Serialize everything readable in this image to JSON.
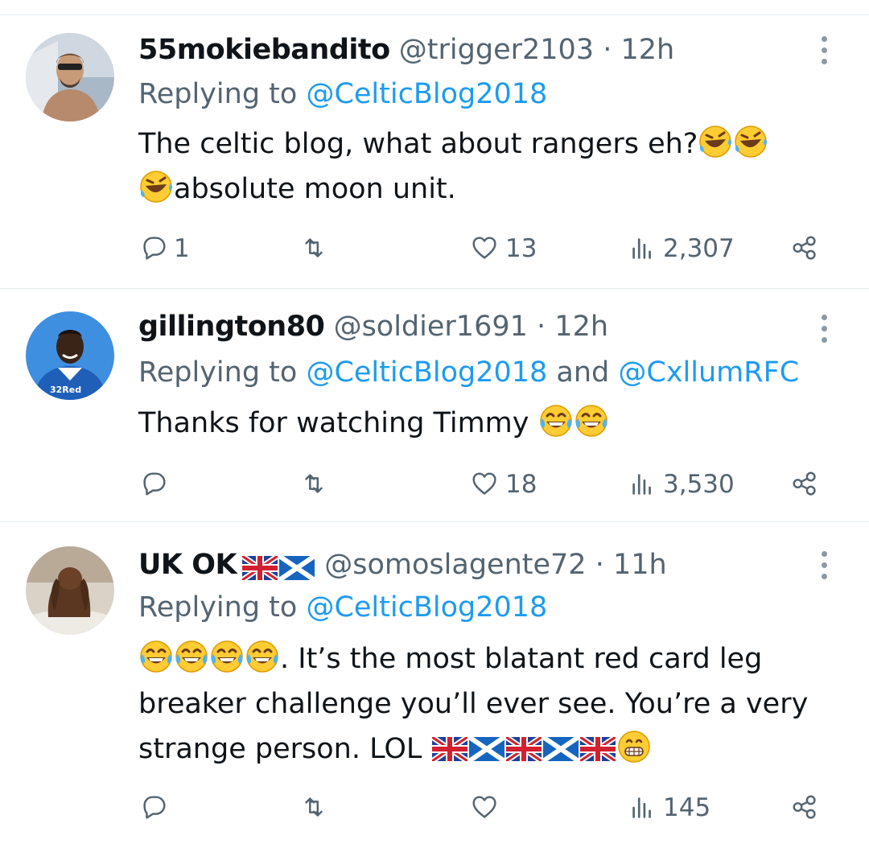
{
  "tweets": [
    {
      "name": "55mokiebandito",
      "handle": "@trigger2103",
      "dot": "·",
      "time": "12h",
      "reply_prefix": "Replying to ",
      "reply_to": "@CelticBlog2018",
      "reply_and": "",
      "reply_to_2": "",
      "text_line1": "The celtic blog, what about rangers eh?",
      "text_line2": "absolute moon unit.",
      "reply_count": "1",
      "like_count": "13",
      "view_count": "2,307",
      "icons": [
        "comment-icon",
        "retweet-icon",
        "heart-icon",
        "views-icon",
        "share-icon"
      ]
    },
    {
      "name": "gillington80",
      "handle": "@soldier1691",
      "dot": "·",
      "time": "12h",
      "reply_prefix": "Replying to ",
      "reply_to": "@CelticBlog2018",
      "reply_and": " and ",
      "reply_to_2": "@CxllumRFC",
      "text_line1": "Thanks for watching Timmy ",
      "reply_count": "",
      "like_count": "18",
      "view_count": "3,530",
      "avatar_text": "32Red"
    },
    {
      "name": "UK OK",
      "handle": "@somoslagente72",
      "dot": "·",
      "time": "11h",
      "reply_prefix": "Replying to ",
      "reply_to": "@CelticBlog2018",
      "reply_and": "",
      "reply_to_2": "",
      "text_line1": ". It’s the most blatant red card leg",
      "text_line2": "breaker challenge you’ll ever see. You’re a very",
      "text_line3": "strange person. LOL ",
      "reply_count": "",
      "like_count": "",
      "view_count": "145"
    }
  ],
  "colors": {
    "accent": "#1d9bf0",
    "muted": "#536471",
    "divider": "#e6ecf0"
  }
}
